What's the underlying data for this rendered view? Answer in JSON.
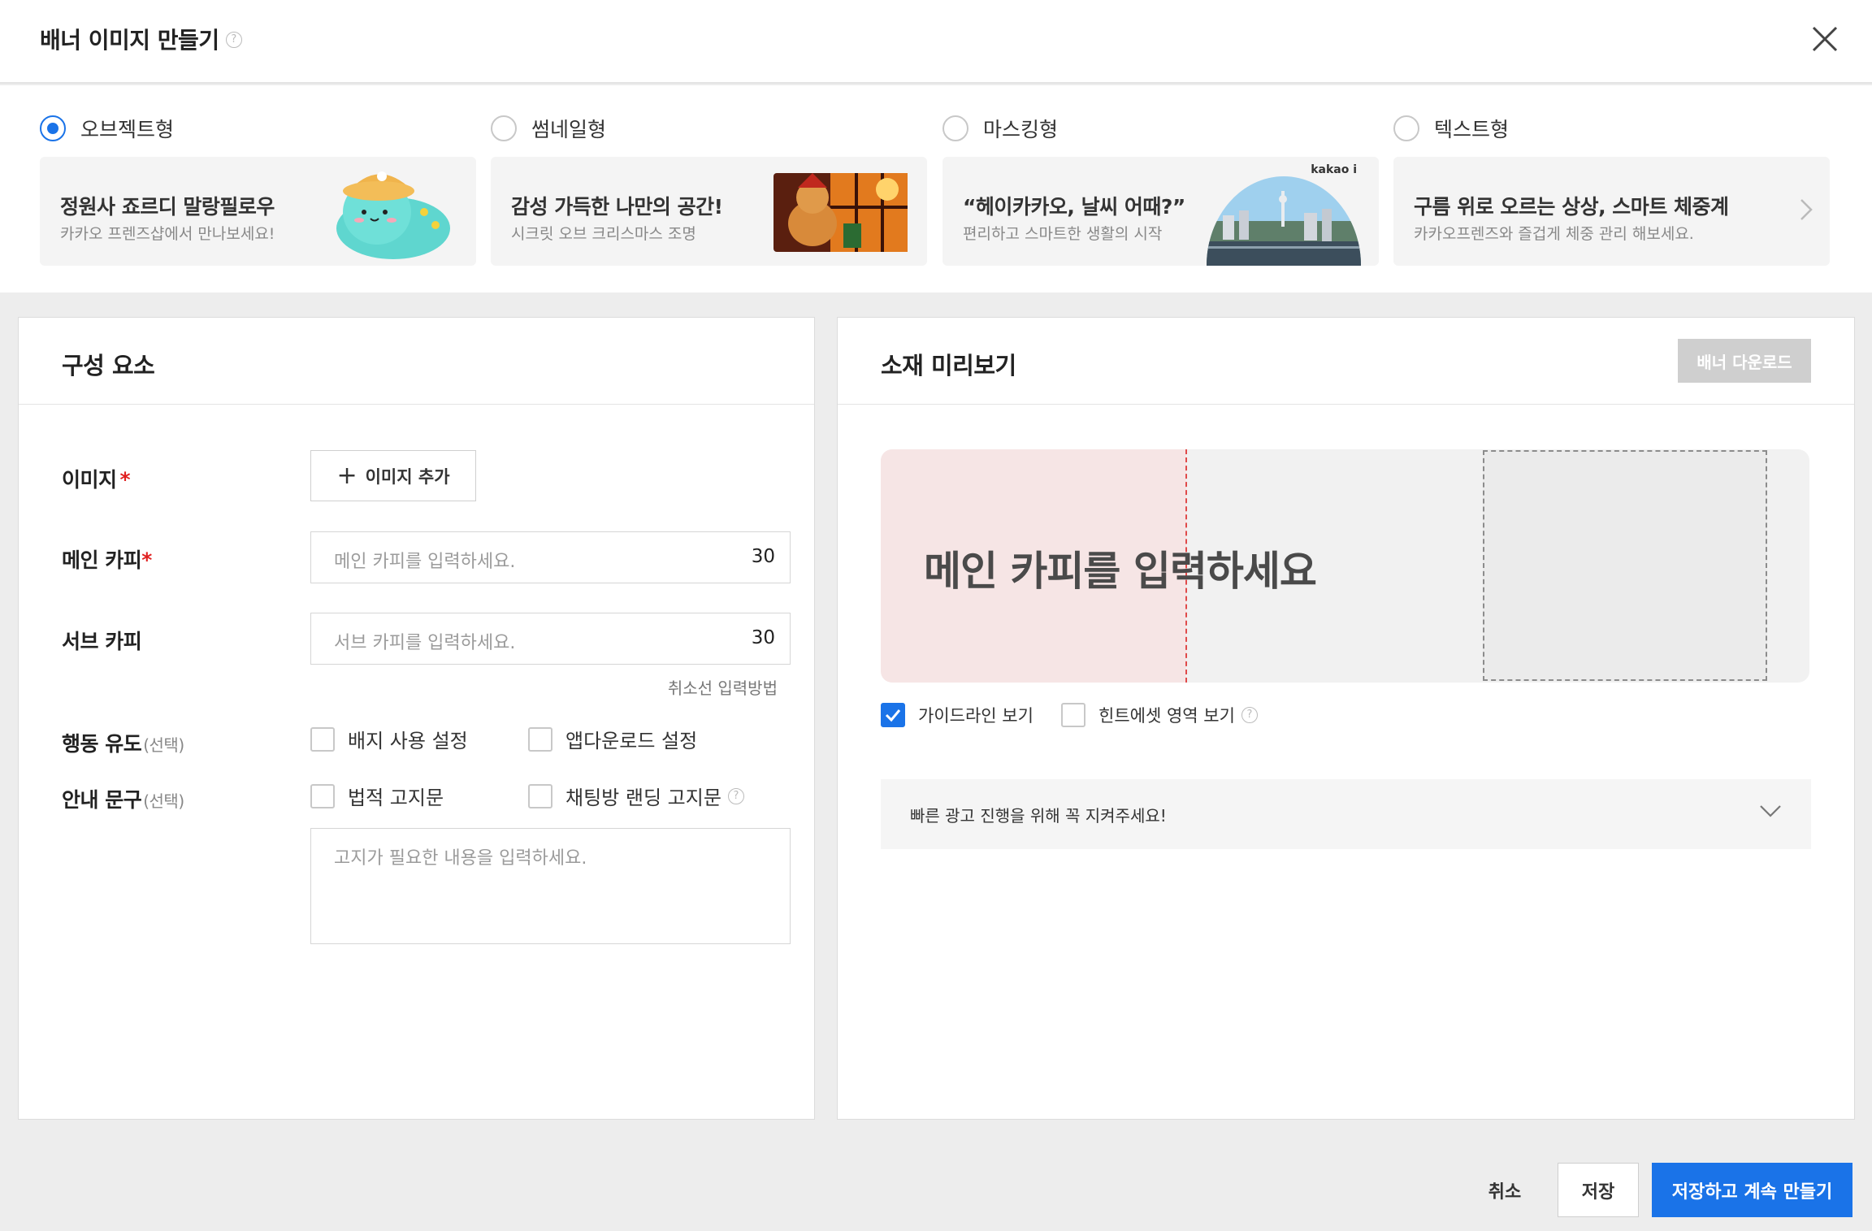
{
  "dialog": {
    "title": "배너 이미지 만들기",
    "help_glyph": "?"
  },
  "types": [
    {
      "label": "오브젝트형",
      "selected": true,
      "card_title": "정원사 죠르디 말랑필로우",
      "card_sub": "카카오 프렌즈샵에서 만나보세요!",
      "thumb_icon": "jordy-pillow-icon"
    },
    {
      "label": "썸네일형",
      "selected": false,
      "card_title": "감성 가득한 나만의 공간!",
      "card_sub": "시크릿 오브 크리스마스 조명",
      "thumb_icon": "christmas-light-photo"
    },
    {
      "label": "마스킹형",
      "selected": false,
      "card_title": "“헤이카카오, 날씨 어때?”",
      "card_sub": "편리하고 스마트한 생활의 시작",
      "thumb_icon": "city-skyline-photo",
      "tag": "kakao i"
    },
    {
      "label": "텍스트형",
      "selected": false,
      "card_title": "구름 위로 오르는 상상, 스마트 체중계",
      "card_sub": "카카오프렌즈와 즐겁게 체중 관리 해보세요."
    }
  ],
  "left_panel": {
    "title": "구성 요소",
    "image_label": "이미지",
    "required_mark": "*",
    "add_image_plus": "+",
    "add_image_label": "이미지 추가",
    "main_copy_label": "메인 카피",
    "main_copy_placeholder": "메인 카피를 입력하세요.",
    "main_copy_count": "30",
    "sub_copy_label": "서브 카피",
    "sub_copy_placeholder": "서브 카피를 입력하세요.",
    "sub_copy_count": "30",
    "cancel_line_help": "취소선 입력방법",
    "cta_label": "행동 유도",
    "optional_mark": "(선택)",
    "badge_setting": "배지 사용 설정",
    "app_download_setting": "앱다운로드 설정",
    "notice_label": "안내 문구",
    "legal_notice": "법적 고지문",
    "chat_landing_notice": "채팅방 랜딩 고지문",
    "notice_placeholder": "고지가 필요한 내용을 입력하세요."
  },
  "right_panel": {
    "title": "소재 미리보기",
    "download_label": "배너 다운로드",
    "preview_copy": "메인 카피를 입력하세요",
    "guideline_label": "가이드라인 보기",
    "guideline_checked": true,
    "hint_label": "힌트에셋 영역 보기",
    "hint_checked": false,
    "accordion_text": "빠른 광고 진행을 위해 꼭 지켜주세요!"
  },
  "footer": {
    "cancel": "취소",
    "save": "저장",
    "save_continue": "저장하고 계속 만들기"
  },
  "colors": {
    "accent": "#1a73e8",
    "required": "#e02020",
    "guide_area": "#f6e5e5",
    "guide_line": "#e04a4a"
  }
}
